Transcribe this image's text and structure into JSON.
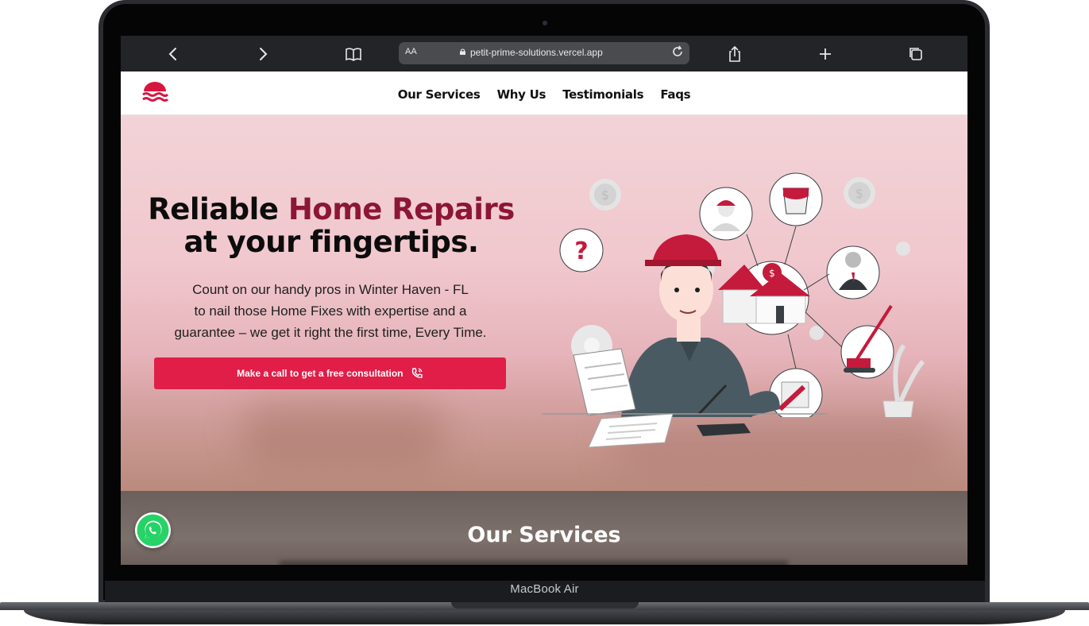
{
  "device": {
    "label": "MacBook Air"
  },
  "browser": {
    "url": "petit-prime-solutions.vercel.app",
    "text_size_label": "AA",
    "back_icon": "chevron-left-icon",
    "forward_icon": "chevron-right-icon",
    "bookmarks_icon": "book-icon",
    "reload_icon": "reload-icon",
    "share_icon": "share-icon",
    "new_tab_icon": "plus-icon",
    "tabs_icon": "tabs-icon"
  },
  "nav": {
    "logo_icon": "waves-logo-icon",
    "links": [
      "Our Services",
      "Why Us",
      "Testimonials",
      "Faqs"
    ]
  },
  "hero": {
    "headline_part1": "Reliable ",
    "headline_accent": "Home Repairs",
    "headline_line2": "at your fingertips.",
    "sub_line1": "Count on our handy pros in Winter Haven - FL",
    "sub_line2": "to nail those Home Fixes with expertise and a",
    "sub_line3": "guarantee – we get it right the first time, Every Time.",
    "cta_label": "Make a call to get a free consultation",
    "cta_icon": "phone-call-icon"
  },
  "services": {
    "title": "Our Services"
  },
  "whatsapp": {
    "icon": "whatsapp-icon"
  },
  "colors": {
    "accent": "#e01e48",
    "headline_accent": "#8c1635",
    "logo": "#d7163f"
  }
}
